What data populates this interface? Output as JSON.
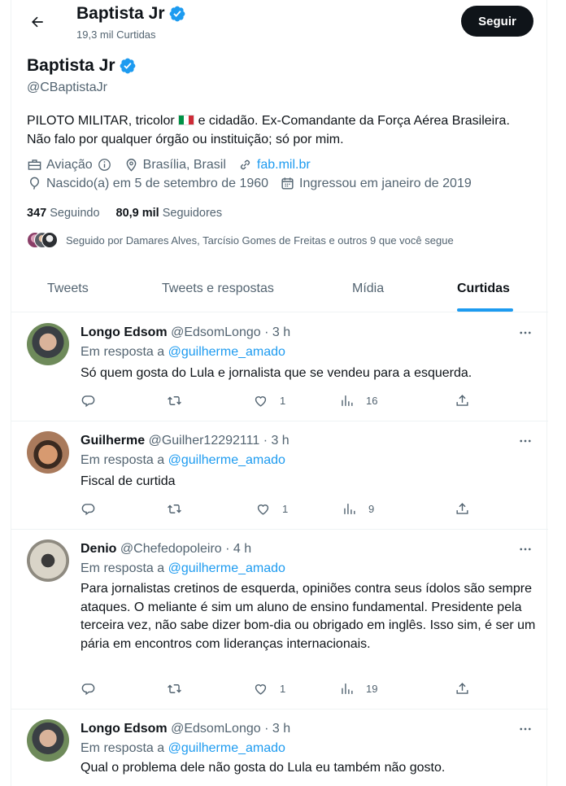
{
  "header": {
    "name": "Baptista Jr",
    "likes_count": "19,3 mil Curtidas",
    "follow_label": "Seguir"
  },
  "profile": {
    "name": "Baptista Jr",
    "handle": "@CBaptistaJr",
    "bio_part1": "PILOTO MILITAR, tricolor",
    "bio_part2": "e cidadão. Ex-Comandante da Força Aérea Brasileira.",
    "bio_line2": "Não falo por qualquer órgão ou instituição; só por mim.",
    "category": "Aviação",
    "location": "Brasília, Brasil",
    "website": "fab.mil.br",
    "birth": "Nascido(a) em 5 de setembro de 1960",
    "joined": "Ingressou em janeiro de 2019",
    "following_count": "347",
    "following_label": "Seguindo",
    "followers_count": "80,9 mil",
    "followers_label": "Seguidores",
    "followed_by": "Seguido por Damares Alves, Tarcísio Gomes de Freitas e outros 9 que você segue"
  },
  "tabs": [
    {
      "label": "Tweets"
    },
    {
      "label": "Tweets e respostas"
    },
    {
      "label": "Mídia"
    },
    {
      "label": "Curtidas"
    }
  ],
  "tweets": [
    {
      "name": "Longo Edsom",
      "handle": "@EdsomLongo",
      "time": "· 3 h",
      "reply_prefix": "Em resposta a",
      "reply_to": "@guilherme_amado",
      "text": "Só quem gosta do Lula e jornalista que se vendeu para a esquerda.",
      "likes": "1",
      "views": "16"
    },
    {
      "name": "Guilherme",
      "handle": "@Guilher12292111",
      "time": "· 3 h",
      "reply_prefix": "Em resposta a",
      "reply_to": "@guilherme_amado",
      "text": "Fiscal de curtida",
      "likes": "1",
      "views": "9"
    },
    {
      "name": "Denio",
      "handle": "@Chefedopoleiro",
      "time": "· 4 h",
      "reply_prefix": "Em resposta a",
      "reply_to": "@guilherme_amado",
      "text": "Para jornalistas cretinos de esquerda, opiniões contra seus ídolos são sempre ataques. O meliante é sim um aluno de ensino fundamental. Presidente pela terceira vez, não sabe dizer bom-dia ou obrigado em inglês. Isso sim, é ser um pária em encontros com lideranças internacionais.",
      "likes": "1",
      "views": "19"
    },
    {
      "name": "Longo Edsom",
      "handle": "@EdsomLongo",
      "time": "· 3 h",
      "reply_prefix": "Em resposta a",
      "reply_to": "@guilherme_amado",
      "text": "Qual o problema dele não gosta do Lula eu também não gosto."
    }
  ],
  "colors": {
    "accent": "#1d9bf0",
    "text": "#0f1419",
    "muted": "#536471",
    "border": "#eff3f4"
  },
  "icons": [
    "back-arrow-icon",
    "verified-badge-icon",
    "briefcase-icon",
    "info-icon",
    "location-icon",
    "link-icon",
    "balloon-icon",
    "calendar-icon",
    "more-icon",
    "reply-icon",
    "retweet-icon",
    "like-icon",
    "views-icon",
    "share-icon"
  ]
}
